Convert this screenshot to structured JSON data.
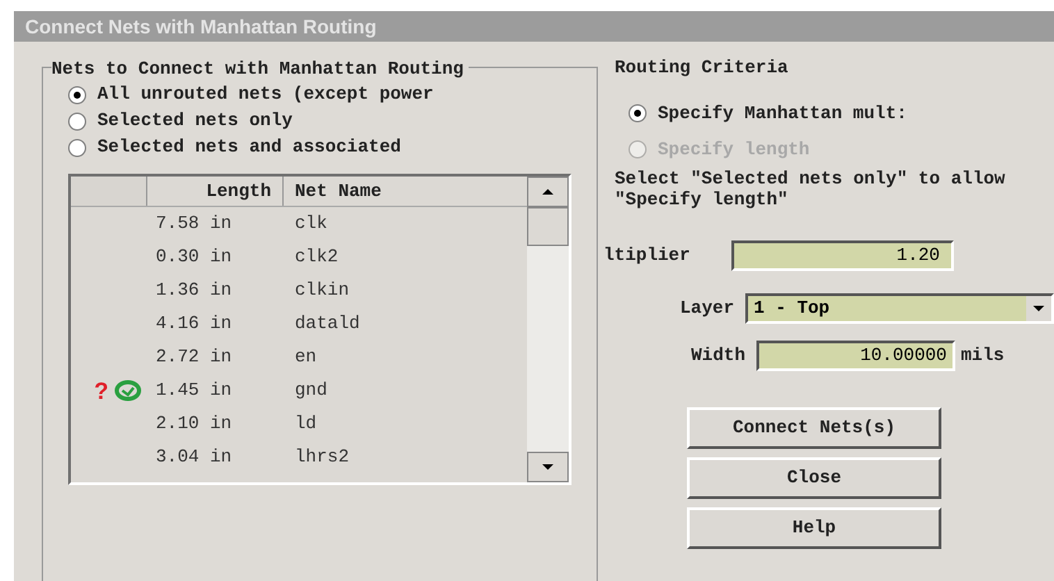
{
  "window": {
    "title": "Connect Nets with Manhattan Routing"
  },
  "nets_group": {
    "title": "Nets to Connect with Manhattan Routing",
    "options": [
      {
        "label": "All unrouted nets (except power",
        "selected": true
      },
      {
        "label": "Selected nets only",
        "selected": false
      },
      {
        "label": "Selected nets and associated",
        "selected": false
      }
    ],
    "table": {
      "columns": [
        "Length",
        "Net Name"
      ],
      "rows": [
        {
          "length": "7.58 in",
          "name": "clk",
          "flagged": false
        },
        {
          "length": "0.30 in",
          "name": "clk2",
          "flagged": false
        },
        {
          "length": "1.36 in",
          "name": "clkin",
          "flagged": false
        },
        {
          "length": "4.16 in",
          "name": "datald",
          "flagged": false
        },
        {
          "length": "2.72 in",
          "name": "en",
          "flagged": false
        },
        {
          "length": "1.45 in",
          "name": "gnd",
          "flagged": true,
          "marker": "?"
        },
        {
          "length": "2.10 in",
          "name": "ld",
          "flagged": false
        },
        {
          "length": "3.04 in",
          "name": "lhrs2",
          "flagged": false
        }
      ]
    }
  },
  "criteria_group": {
    "title": "Routing Criteria",
    "options": [
      {
        "label": "Specify Manhattan mult:",
        "selected": true,
        "disabled": false
      },
      {
        "label": "Specify length",
        "selected": false,
        "disabled": true
      }
    ],
    "hint": "Select \"Selected nets only\" to allow \"Specify length\"",
    "multiplier": {
      "label": "ltiplier",
      "value": "1.20"
    },
    "layer": {
      "label": "Layer",
      "value": "1 - Top"
    },
    "width": {
      "label": "Width",
      "value": "10.00000",
      "unit": "mils"
    }
  },
  "buttons": [
    "Connect Nets(s)",
    "Close",
    "Help"
  ]
}
